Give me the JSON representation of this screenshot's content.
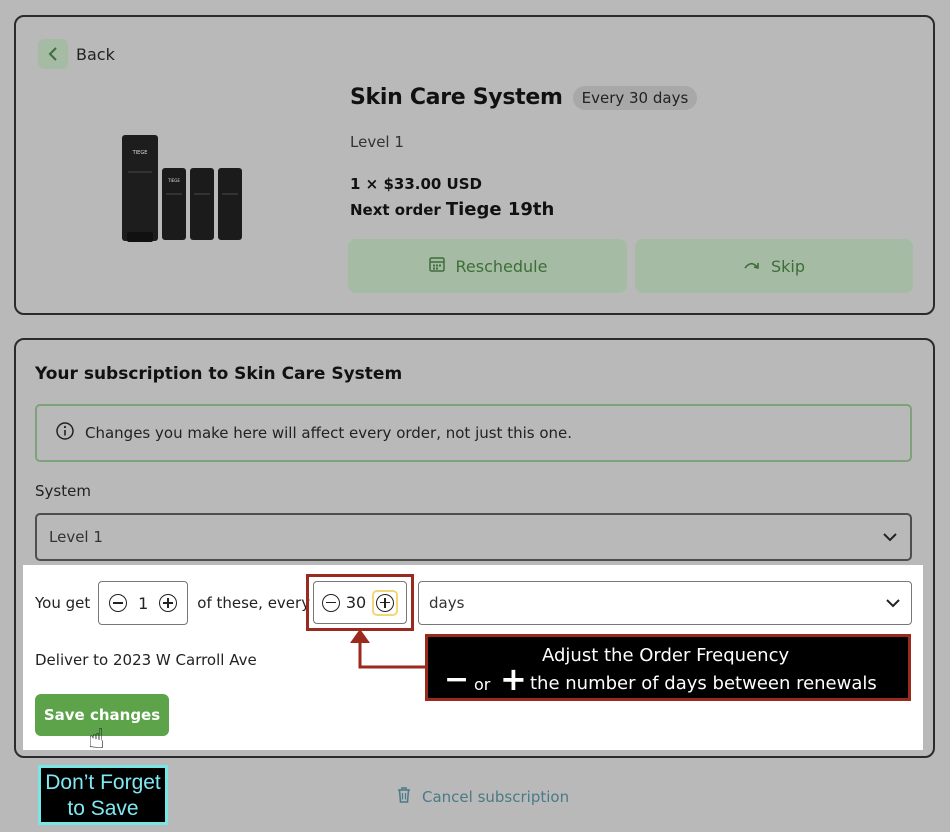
{
  "product": {
    "back_label": "Back",
    "title": "Skin Care System",
    "frequency_badge": "Every 30 days",
    "level": "Level 1",
    "price_line": "1 × $33.00 USD",
    "next_order_label": "Next order",
    "next_order_date": "Tiege 19th",
    "reschedule_label": "Reschedule",
    "skip_label": "Skip",
    "image_brand": "TIEGE"
  },
  "subscription": {
    "title": "Your subscription to Skin Care System",
    "info_text": "Changes you make here will affect every order, not just this one.",
    "system_label": "System",
    "system_value": "Level 1",
    "you_get_label": "You get",
    "quantity": "1",
    "of_these_label": "of these, every",
    "frequency_value": "30",
    "unit_value": "days",
    "deliver_to": "Deliver to 2023 W Carroll Ave",
    "save_label": "Save changes",
    "cancel_label": "Cancel subscription"
  },
  "annotations": {
    "frequency_line1": "Adjust the Order Frequency",
    "frequency_minus": "−",
    "frequency_or": "or",
    "frequency_plus": "+",
    "frequency_line2": "the number of days between renewals",
    "save_note_line1": "Don’t Forget",
    "save_note_line2": "to Save"
  },
  "colors": {
    "accent_green": "#5ca34a",
    "annotation_red": "#9b2a1e",
    "annotation_cyan": "#79e6e6"
  }
}
